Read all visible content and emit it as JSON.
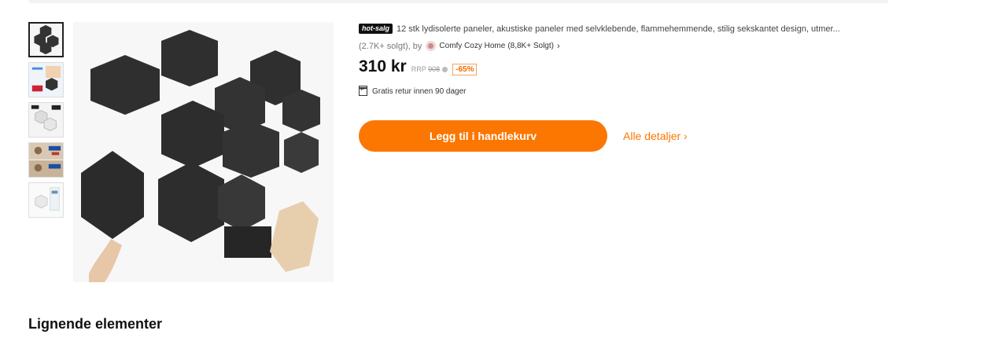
{
  "product": {
    "badge": "hot-salg",
    "title": "12 stk lydisolerte paneler, akustiske paneler med selvklebende, flammehemmende, stilig sekskantet design, utmer...",
    "sold_count": "(2.7K+ solgt), by",
    "seller_name": "Comfy Cozy Home",
    "seller_sold": "(8,8K+ Solgt)",
    "seller_chevron": "›",
    "price": "310 kr",
    "rrp_label": "RRP",
    "rrp_value": "908",
    "discount": "-65%",
    "return_policy": "Gratis retur innen 90 dager"
  },
  "actions": {
    "add_to_cart": "Legg til i handlekurv",
    "all_details": "Alle detaljer ›"
  },
  "similar": {
    "heading": "Lignende elementer"
  },
  "icons": {
    "return": "return-box-icon",
    "info": "info-icon",
    "seller_avatar": "seller-avatar"
  },
  "colors": {
    "accent": "#fb7701",
    "badge_bg": "#111111"
  }
}
